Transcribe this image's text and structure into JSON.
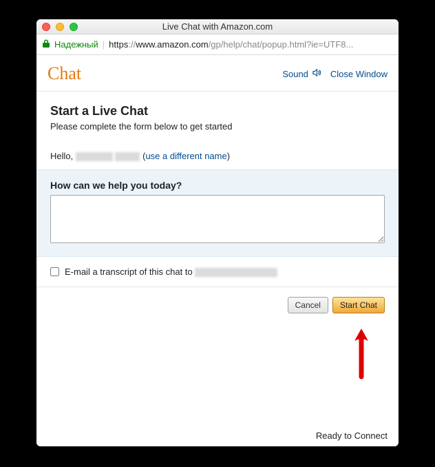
{
  "titlebar": {
    "title": "Live Chat with Amazon.com"
  },
  "addressbar": {
    "secure_label": "Надежный",
    "https": "https",
    "sep": "://",
    "domain": "www.amazon.com",
    "path": "/gp/help/chat/popup.html?ie=UTF8..."
  },
  "header": {
    "brand": "Chat",
    "sound_label": "Sound",
    "close_label": "Close Window"
  },
  "start": {
    "title": "Start a Live Chat",
    "subtitle": "Please complete the form below to get started",
    "hello_prefix": "Hello, ",
    "paren_open": " (",
    "diff_name": "use a different name",
    "paren_close": ")"
  },
  "question": {
    "label": "How can we help you today?",
    "value": ""
  },
  "email": {
    "label_prefix": "E-mail a transcript of this chat to "
  },
  "buttons": {
    "cancel": "Cancel",
    "start": "Start Chat"
  },
  "footer": {
    "status": "Ready to Connect"
  }
}
